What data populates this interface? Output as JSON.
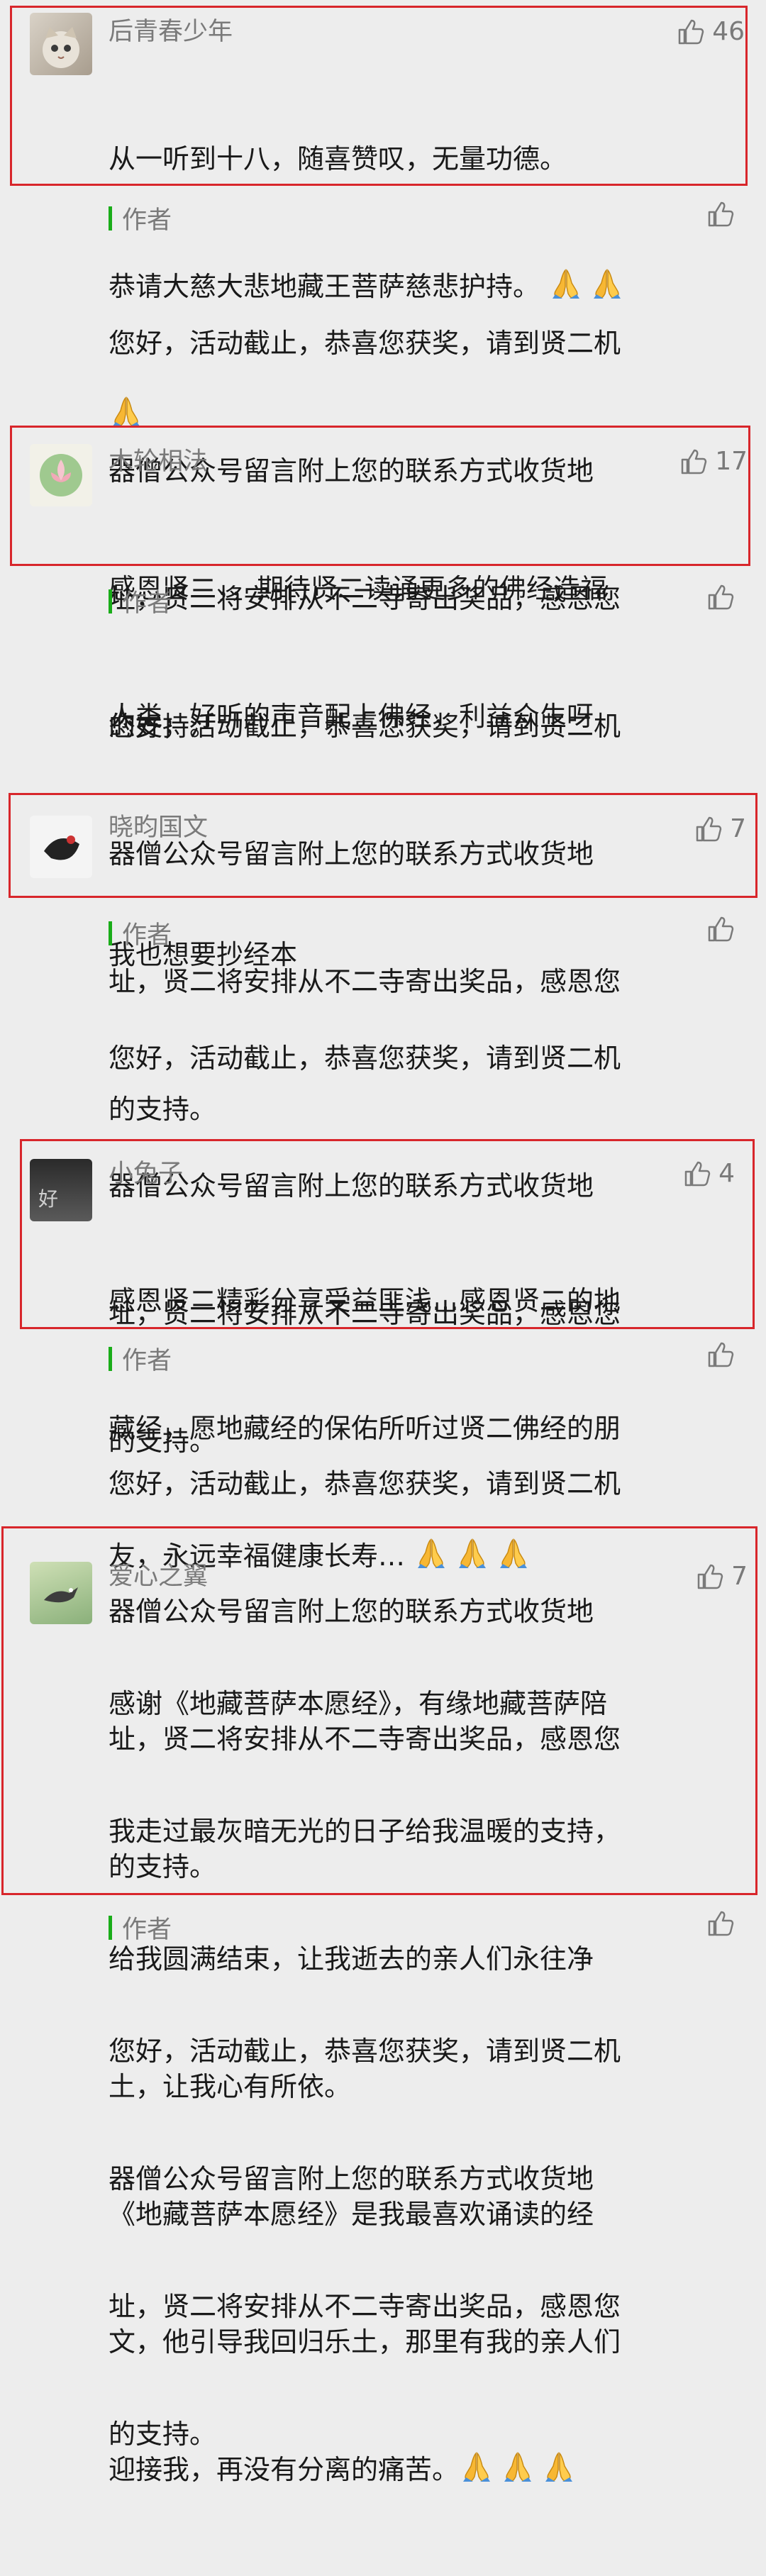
{
  "comments": [
    {
      "nick": "后青春少年",
      "likes": "46",
      "avatar_icon": "cat-avatar-icon",
      "lines": [
        "从一听到十八，随喜赞叹，无量功德。",
        "恭请大慈大悲地藏王菩萨慈悲护持。"
      ],
      "reply_author": "作者",
      "reply_lines": [
        "您好，活动截止，恭喜您获奖，请到贤二机",
        "器僧公众号留言附上您的联系方式收货地",
        "址，贤二将安排从不二寺寄出奖品，感恩您",
        "的支持。"
      ]
    },
    {
      "nick": "木轮相法",
      "likes": "17",
      "avatar_icon": "lotus-avatar-icon",
      "lines": [
        "感恩贤二，，期待贤二读诵更多的佛经造福",
        "人类，好听的声音配上佛经，利益众生呀"
      ],
      "reply_author": "作者",
      "reply_lines": [
        "您好，活动截止，恭喜您获奖，请到贤二机",
        "器僧公众号留言附上您的联系方式收货地",
        "址，贤二将安排从不二寺寄出奖品，感恩您",
        "的支持。"
      ]
    },
    {
      "nick": "晓昀国文",
      "likes": "7",
      "avatar_icon": "ink-avatar-icon",
      "lines": [
        "我也想要抄经本"
      ],
      "reply_author": "作者",
      "reply_lines": [
        "您好，活动截止，恭喜您获奖，请到贤二机",
        "器僧公众号留言附上您的联系方式收货地",
        "址，贤二将安排从不二寺寄出奖品，感恩您",
        "的支持。"
      ]
    },
    {
      "nick": "小兔子",
      "likes": "4",
      "avatar_icon": "dark-avatar-icon",
      "lines": [
        "感恩贤二精彩分享受益匪浅…感恩贤二的地",
        "藏经，愿地藏经的保佑所听过贤二佛经的朋",
        "友，永远幸福健康长寿…"
      ],
      "reply_author": "作者",
      "reply_lines": [
        "您好，活动截止，恭喜您获奖，请到贤二机",
        "器僧公众号留言附上您的联系方式收货地",
        "址，贤二将安排从不二寺寄出奖品，感恩您",
        "的支持。"
      ]
    },
    {
      "nick": "爱心之翼",
      "likes": "7",
      "avatar_icon": "bird-avatar-icon",
      "lines": [
        "感谢《地藏菩萨本愿经》，有缘地藏菩萨陪",
        "我走过最灰暗无光的日子给我温暖的支持，",
        "给我圆满结束，让我逝去的亲人们永往净",
        "土，让我心有所依。",
        "《地藏菩萨本愿经》是我最喜欢诵读的经",
        "文，他引导我回归乐土，那里有我的亲人们",
        "迎接我，再没有分离的痛苦。"
      ],
      "reply_author": "作者",
      "reply_lines": [
        "您好，活动截止，恭喜您获奖，请到贤二机",
        "器僧公众号留言附上您的联系方式收货地",
        "址，贤二将安排从不二寺寄出奖品，感恩您",
        "的支持。"
      ]
    }
  ],
  "colors": {
    "highlight": "#d8262b",
    "author_bar": "#1aad19",
    "text": "#191919",
    "meta": "#7a7a7a"
  }
}
